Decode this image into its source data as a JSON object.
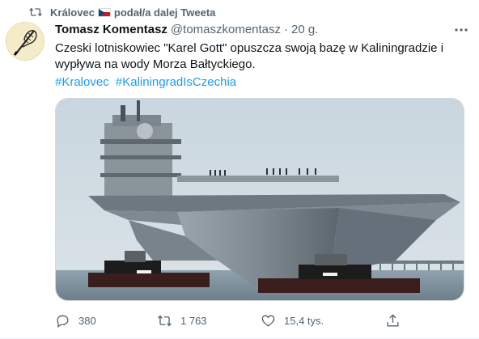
{
  "retweet_banner": {
    "user": "Královec",
    "suffix": "podał/a dalej Tweeta",
    "icon": "retweet-icon",
    "flag": "czech-flag"
  },
  "tweet": {
    "author_name": "Tomasz Komentasz",
    "author_handle": "@tomaszkomentasz",
    "separator": "·",
    "time": "20 g.",
    "text": "Czeski lotniskowiec \"Karel Gott\" opuszcza swoją bazę w Kaliningradzie i wypływa na wody Morza Bałtyckiego.",
    "hashtags": [
      "#Kralovec",
      "#KaliningradIsCzechia"
    ],
    "media_alt": "aircraft-carrier-photo"
  },
  "actions": {
    "reply_count": "380",
    "retweet_count": "1 763",
    "like_count": "15,4 tys."
  },
  "colors": {
    "link": "#1d9bf0",
    "secondary_text": "#536471",
    "primary_text": "#0f1419"
  }
}
